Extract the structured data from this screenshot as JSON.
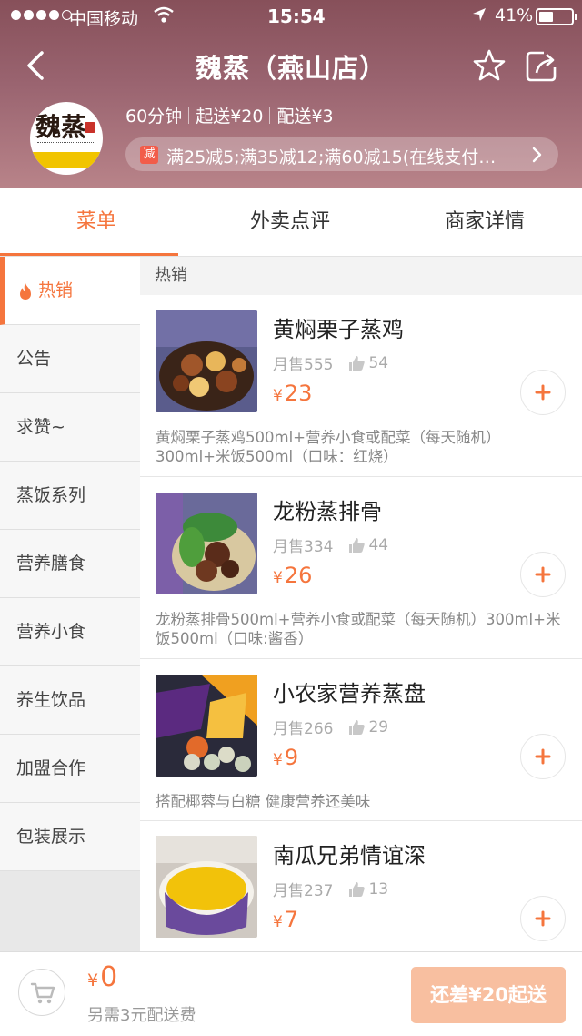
{
  "status_bar": {
    "carrier": "中国移动",
    "time": "15:54",
    "battery": "41%",
    "battery_level": 0.41
  },
  "header": {
    "title": "魏蒸（燕山店）",
    "logo_text": "魏蒸",
    "delivery_time": "60分钟",
    "min_order": "起送¥20",
    "delivery_fee": "配送¥3",
    "promo_tag": "减",
    "promo_text": "满25减5;满35减12;满60减15(在线支付…"
  },
  "tabs": [
    {
      "label": "菜单"
    },
    {
      "label": "外卖点评"
    },
    {
      "label": "商家详情"
    }
  ],
  "categories": [
    {
      "label": "热销"
    },
    {
      "label": "公告"
    },
    {
      "label": "求赞~"
    },
    {
      "label": "蒸饭系列"
    },
    {
      "label": "营养膳食"
    },
    {
      "label": "营养小食"
    },
    {
      "label": "养生饮品"
    },
    {
      "label": "加盟合作"
    },
    {
      "label": "包装展示"
    }
  ],
  "section_title": "热销",
  "dishes": [
    {
      "name": "黄焖栗子蒸鸡",
      "sold": "月售555",
      "likes": "54",
      "currency": "¥",
      "price": "23",
      "desc": "黄焖栗子蒸鸡500ml+营养小食或配菜（每天随机）300ml+米饭500ml（口味：红烧）"
    },
    {
      "name": "龙粉蒸排骨",
      "sold": "月售334",
      "likes": "44",
      "currency": "¥",
      "price": "26",
      "desc": "龙粉蒸排骨500ml+营养小食或配菜（每天随机）300ml+米饭500ml（口味:酱香）"
    },
    {
      "name": "小农家营养蒸盘",
      "sold": "月售266",
      "likes": "29",
      "currency": "¥",
      "price": "9",
      "desc": "搭配椰蓉与白糖  健康营养还美味"
    },
    {
      "name": "南瓜兄弟情谊深",
      "sold": "月售237",
      "likes": "13",
      "currency": "¥",
      "price": "7",
      "desc": ""
    }
  ],
  "cart": {
    "currency": "¥",
    "total": "0",
    "note": "另需3元配送费",
    "checkout_label": "还差¥20起送"
  },
  "colors": {
    "accent": "#f5753d",
    "header": "#9a6470",
    "checkout_disabled": "#f8bfa0"
  }
}
